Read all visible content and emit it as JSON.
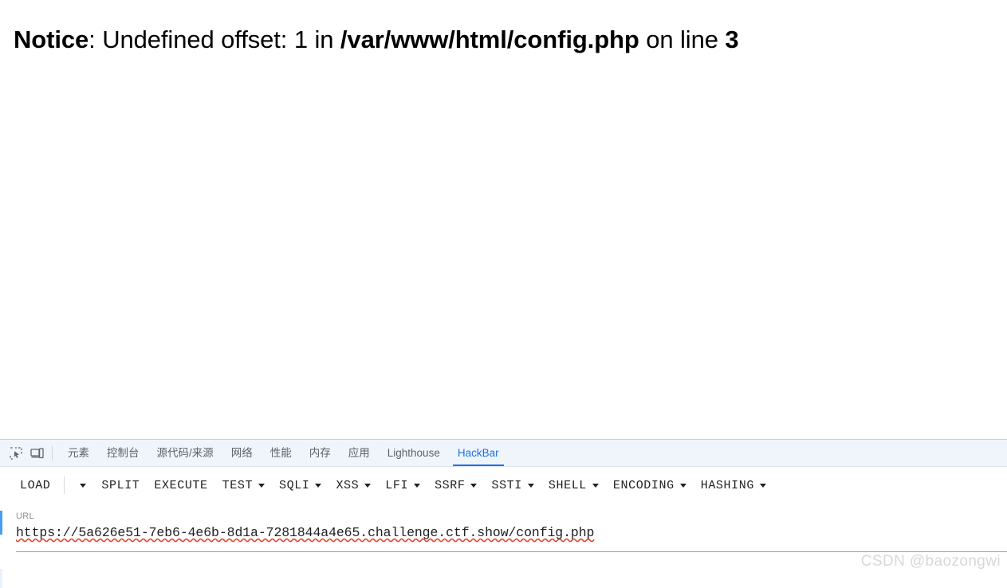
{
  "page": {
    "notice": {
      "label": "Notice",
      "colon": ": ",
      "message": "Undefined offset: 1 in ",
      "file": "/var/www/html/config.php",
      "on_line": " on line ",
      "line_number": "3"
    }
  },
  "devtools": {
    "icons": {
      "inspect": "inspect-element-icon",
      "device": "device-toolbar-icon"
    },
    "tabs": [
      {
        "label": "元素",
        "active": false
      },
      {
        "label": "控制台",
        "active": false
      },
      {
        "label": "源代码/来源",
        "active": false
      },
      {
        "label": "网络",
        "active": false
      },
      {
        "label": "性能",
        "active": false
      },
      {
        "label": "内存",
        "active": false
      },
      {
        "label": "应用",
        "active": false
      },
      {
        "label": "Lighthouse",
        "active": false
      },
      {
        "label": "HackBar",
        "active": true
      }
    ],
    "active_tab": "HackBar",
    "accent_color": "#1a73e8"
  },
  "hackbar": {
    "buttons": [
      {
        "label": "LOAD",
        "caret": false,
        "split_caret": true
      },
      {
        "label": "SPLIT",
        "caret": false,
        "split_caret": false
      },
      {
        "label": "EXECUTE",
        "caret": false,
        "split_caret": false
      },
      {
        "label": "TEST",
        "caret": true,
        "split_caret": false
      },
      {
        "label": "SQLI",
        "caret": true,
        "split_caret": false
      },
      {
        "label": "XSS",
        "caret": true,
        "split_caret": false
      },
      {
        "label": "LFI",
        "caret": true,
        "split_caret": false
      },
      {
        "label": "SSRF",
        "caret": true,
        "split_caret": false
      },
      {
        "label": "SSTI",
        "caret": true,
        "split_caret": false
      },
      {
        "label": "SHELL",
        "caret": true,
        "split_caret": false
      },
      {
        "label": "ENCODING",
        "caret": true,
        "split_caret": false
      },
      {
        "label": "HASHING",
        "caret": true,
        "split_caret": false
      }
    ],
    "url_field": {
      "label": "URL",
      "value": "https://5a626e51-7eb6-4e6b-8d1a-7281844a4e65.challenge.ctf.show/config.php",
      "placeholder": "URL"
    }
  },
  "watermark": {
    "text": "CSDN @baozongwi"
  }
}
